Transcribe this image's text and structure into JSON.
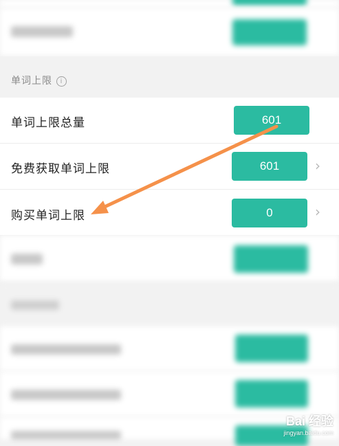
{
  "section_word_limit": {
    "title": "单词上限",
    "info_icon": "info-circle-icon"
  },
  "rows": {
    "total_limit": {
      "label": "单词上限总量",
      "value": "601"
    },
    "free_limit": {
      "label": "免费获取单词上限",
      "value": "601"
    },
    "bought_limit": {
      "label": "购买单词上限",
      "value": "0"
    }
  },
  "icons": {
    "chevron": "›"
  },
  "annotation": {
    "arrow_color": "#f5914a"
  },
  "watermark": {
    "brand": "Bai 经验",
    "site": "jingyan.baidu.com"
  },
  "colors": {
    "accent": "#2bbba1",
    "background": "#f2f2f2"
  }
}
